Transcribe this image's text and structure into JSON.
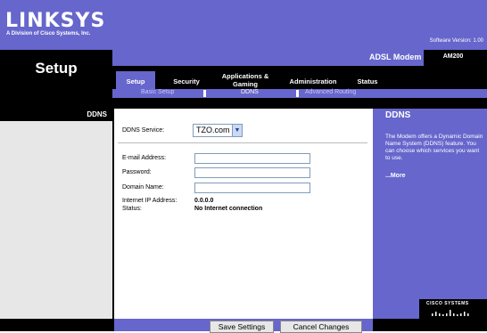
{
  "header": {
    "logo_text": "LINKSYS",
    "logo_subtitle": "A Division of Cisco Systems, Inc.",
    "software_version": "Software Version: 1.00"
  },
  "page": {
    "title": "Setup",
    "section_label": "DDNS"
  },
  "product": {
    "name": "ADSL Modem",
    "model": "AM200"
  },
  "nav": {
    "tabs": [
      {
        "label": "Setup"
      },
      {
        "label": "Security"
      },
      {
        "label": "Applications & Gaming"
      },
      {
        "label": "Administration"
      },
      {
        "label": "Status"
      }
    ],
    "subtabs": [
      {
        "label": "Basic Setup"
      },
      {
        "label": "DDNS"
      },
      {
        "label": "Advanced Routing"
      }
    ]
  },
  "form": {
    "ddns_service_label": "DDNS Service:",
    "ddns_service_value": "TZO.com",
    "email_label": "E-mail Address:",
    "email_value": "",
    "password_label": "Password:",
    "password_value": "",
    "domain_label": "Domain Name:",
    "domain_value": "",
    "ip_label": "Internet IP Address:",
    "ip_value": "0.0.0.0",
    "status_label": "Status:",
    "status_value": "No Internet connection"
  },
  "help": {
    "title": "DDNS",
    "text": "The Modem offers a Dynamic Domain Name System (DDNS) feature. You can choose which services you want to use.",
    "more": "...More"
  },
  "footer": {
    "cisco_text": "CISCO SYSTEMS",
    "save_button": "Save Settings",
    "cancel_button": "Cancel Changes"
  },
  "colors": {
    "brand_purple": "#6666cc",
    "black": "#000000",
    "grey": "#e7e7e7"
  }
}
